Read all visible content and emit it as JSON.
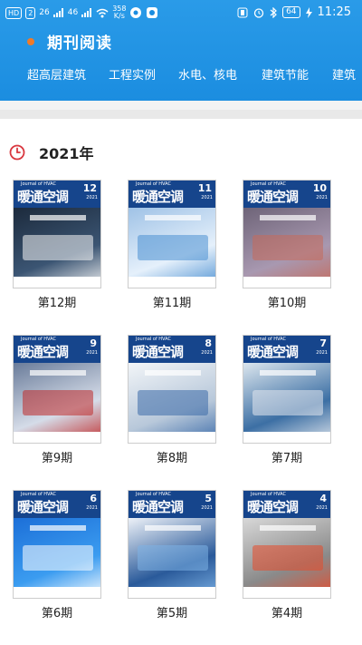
{
  "status_bar": {
    "left_chips": [
      "HD",
      "2"
    ],
    "signal_a": "26",
    "signal_b": "46",
    "speed": "358",
    "speed_unit": "K/s",
    "battery": "64",
    "time": "11:25"
  },
  "header": {
    "title": "期刊阅读",
    "accent_color": "#f07a28",
    "bg_color": "#1b8de0"
  },
  "tabs": [
    "超高层建筑",
    "工程实例",
    "水电、核电",
    "建筑节能",
    "建筑"
  ],
  "year_section": {
    "year_label": "2021年",
    "clock_icon": "clock-icon"
  },
  "magazine": {
    "logo": "暖通空调",
    "english": "Journal of HVAC",
    "year": "2021"
  },
  "issues": [
    {
      "label": "第12期",
      "number": "12",
      "palette": [
        "#1c2a3c",
        "#3b5573",
        "#f5f5f5"
      ]
    },
    {
      "label": "第11期",
      "number": "11",
      "palette": [
        "#9fc2e6",
        "#e5f0fb",
        "#4a8fd1"
      ]
    },
    {
      "label": "第10期",
      "number": "10",
      "palette": [
        "#6e6478",
        "#a898b0",
        "#c76a5a"
      ]
    },
    {
      "label": "第9期",
      "number": "9",
      "palette": [
        "#6a7c9a",
        "#d5dce8",
        "#c02a2a"
      ]
    },
    {
      "label": "第8期",
      "number": "8",
      "palette": [
        "#f2f5f8",
        "#b8c8da",
        "#3a6aa8"
      ]
    },
    {
      "label": "第7期",
      "number": "7",
      "palette": [
        "#dce6ee",
        "#3c6fa4",
        "#e3e8ee"
      ]
    },
    {
      "label": "第6期",
      "number": "6",
      "palette": [
        "#1c6fd8",
        "#3b9cf0",
        "#ffffff"
      ]
    },
    {
      "label": "第5期",
      "number": "5",
      "palette": [
        "#eef2f8",
        "#2a5a9a",
        "#7eb3e6"
      ]
    },
    {
      "label": "第4期",
      "number": "4",
      "palette": [
        "#d8d8d8",
        "#8a8a8a",
        "#e84a2a"
      ]
    }
  ]
}
